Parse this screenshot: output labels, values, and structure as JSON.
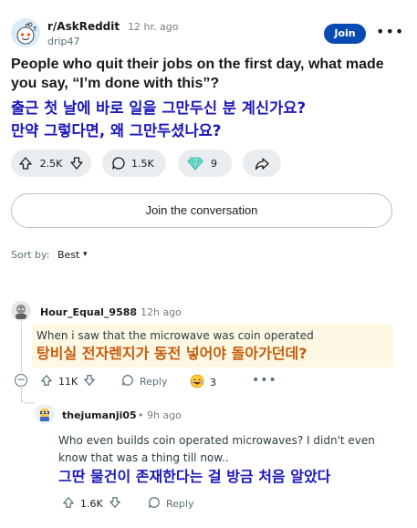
{
  "post": {
    "subreddit": "r/AskReddit",
    "time": "12 hr. ago",
    "author": "drip47",
    "join_label": "Join",
    "more_label": "•••",
    "title": "People who quit their jobs on the first day, what made you say, “I’m done with this”?",
    "translation_line1": "출근 첫 날에 바로 일을 그만두신 분 계신가요?",
    "translation_line2": "만약 그렇다면, 왜 그만두셨나요?",
    "upvotes": "2.5K",
    "comments": "1.5K",
    "awards": "9"
  },
  "join_conversation_label": "Join the conversation",
  "sort": {
    "label": "Sort by:",
    "value": "Best"
  },
  "comments": [
    {
      "user": "Hour_Equal_9588",
      "time": "• 12h ago",
      "text": "When i saw that the microwave was coin operated",
      "translation": "탕비실 전자렌지가 동전 넣어야 돌아가던데?",
      "upvotes": "11K",
      "reply_label": "Reply",
      "awards": "3",
      "collapse_label": "−"
    },
    {
      "user": "thejumanji05",
      "time": "• 9h ago",
      "text_line1": "Who even builds coin operated microwaves? I didn't even",
      "text_line2": "know that was a thing till now..",
      "translation": "그딴 물건이 존재한다는 걸 방금 처음 알았다",
      "upvotes": "1.6K",
      "reply_label": "Reply"
    }
  ],
  "colors": {
    "join_button": "#0a4bb3",
    "translation_post": "#1b17b8",
    "translation_comment1": "#c55a0a",
    "translation_comment2": "#1b17b8",
    "highlight": "#fdf8e4",
    "pill_bg": "#eaedef"
  },
  "icons": {
    "subreddit_avatar": "reddit-snoo-icon",
    "upvote": "upvote-arrow-icon",
    "downvote": "downvote-arrow-icon",
    "comments": "comment-bubble-icon",
    "award": "diamond-award-icon",
    "share": "share-arrow-icon",
    "emoji_award": "laughing-emoji-icon"
  }
}
